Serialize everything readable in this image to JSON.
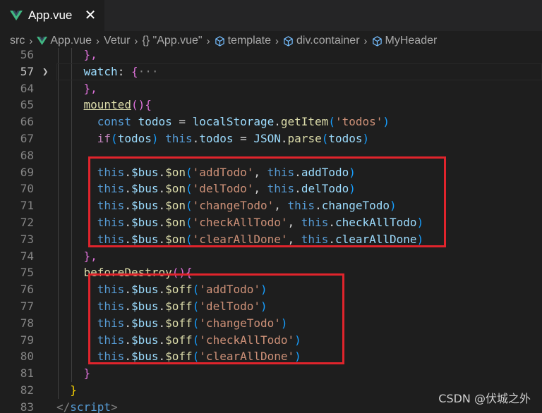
{
  "tab": {
    "title": "App.vue",
    "close": "✕"
  },
  "breadcrumbs": {
    "items": [
      "src",
      "App.vue",
      "Vetur",
      "{} \"App.vue\"",
      "template",
      "div.container",
      "MyHeader"
    ]
  },
  "lines": [
    {
      "n": "56",
      "tokens": [
        {
          "t": "},",
          "c": "k-brk2"
        }
      ]
    },
    {
      "n": "57",
      "fold": true,
      "tokens": [
        {
          "t": "watch",
          "c": "k-var"
        },
        {
          "t": ": ",
          "c": "k-plain"
        },
        {
          "t": "{",
          "c": "k-brk2"
        },
        {
          "t": "···",
          "c": "k-grey"
        }
      ]
    },
    {
      "n": "64",
      "tokens": [
        {
          "t": "},",
          "c": "k-brk2"
        }
      ]
    },
    {
      "n": "65",
      "tokens": [
        {
          "t": "mounted",
          "c": "k-fn underline"
        },
        {
          "t": "(){",
          "c": "k-brk2"
        }
      ]
    },
    {
      "n": "66",
      "tokens": [
        {
          "t": "  const ",
          "c": "k-blue"
        },
        {
          "t": "todos",
          "c": "k-var"
        },
        {
          "t": " = ",
          "c": "k-plain"
        },
        {
          "t": "localStorage",
          "c": "k-var"
        },
        {
          "t": ".",
          "c": "k-plain"
        },
        {
          "t": "getItem",
          "c": "k-fn"
        },
        {
          "t": "(",
          "c": "k-brk3"
        },
        {
          "t": "'todos'",
          "c": "k-str"
        },
        {
          "t": ")",
          "c": "k-brk3"
        }
      ]
    },
    {
      "n": "67",
      "tokens": [
        {
          "t": "  if",
          "c": "k-purple"
        },
        {
          "t": "(",
          "c": "k-brk3"
        },
        {
          "t": "todos",
          "c": "k-var"
        },
        {
          "t": ") ",
          "c": "k-brk3"
        },
        {
          "t": "this",
          "c": "k-blue"
        },
        {
          "t": ".",
          "c": "k-plain"
        },
        {
          "t": "todos",
          "c": "k-var"
        },
        {
          "t": " = ",
          "c": "k-plain"
        },
        {
          "t": "JSON",
          "c": "k-var"
        },
        {
          "t": ".",
          "c": "k-plain"
        },
        {
          "t": "parse",
          "c": "k-fn"
        },
        {
          "t": "(",
          "c": "k-brk3"
        },
        {
          "t": "todos",
          "c": "k-var"
        },
        {
          "t": ")",
          "c": "k-brk3"
        }
      ]
    },
    {
      "n": "68",
      "tokens": []
    },
    {
      "n": "69",
      "tokens": [
        {
          "t": "  this",
          "c": "k-blue"
        },
        {
          "t": ".",
          "c": "k-plain"
        },
        {
          "t": "$bus",
          "c": "k-var"
        },
        {
          "t": ".",
          "c": "k-plain"
        },
        {
          "t": "$on",
          "c": "k-fn"
        },
        {
          "t": "(",
          "c": "k-brk3"
        },
        {
          "t": "'addTodo'",
          "c": "k-str"
        },
        {
          "t": ", ",
          "c": "k-plain"
        },
        {
          "t": "this",
          "c": "k-blue"
        },
        {
          "t": ".",
          "c": "k-plain"
        },
        {
          "t": "addTodo",
          "c": "k-var"
        },
        {
          "t": ")",
          "c": "k-brk3"
        }
      ]
    },
    {
      "n": "70",
      "tokens": [
        {
          "t": "  this",
          "c": "k-blue"
        },
        {
          "t": ".",
          "c": "k-plain"
        },
        {
          "t": "$bus",
          "c": "k-var"
        },
        {
          "t": ".",
          "c": "k-plain"
        },
        {
          "t": "$on",
          "c": "k-fn"
        },
        {
          "t": "(",
          "c": "k-brk3"
        },
        {
          "t": "'delTodo'",
          "c": "k-str"
        },
        {
          "t": ", ",
          "c": "k-plain"
        },
        {
          "t": "this",
          "c": "k-blue"
        },
        {
          "t": ".",
          "c": "k-plain"
        },
        {
          "t": "delTodo",
          "c": "k-var"
        },
        {
          "t": ")",
          "c": "k-brk3"
        }
      ]
    },
    {
      "n": "71",
      "tokens": [
        {
          "t": "  this",
          "c": "k-blue"
        },
        {
          "t": ".",
          "c": "k-plain"
        },
        {
          "t": "$bus",
          "c": "k-var"
        },
        {
          "t": ".",
          "c": "k-plain"
        },
        {
          "t": "$on",
          "c": "k-fn"
        },
        {
          "t": "(",
          "c": "k-brk3"
        },
        {
          "t": "'changeTodo'",
          "c": "k-str"
        },
        {
          "t": ", ",
          "c": "k-plain"
        },
        {
          "t": "this",
          "c": "k-blue"
        },
        {
          "t": ".",
          "c": "k-plain"
        },
        {
          "t": "changeTodo",
          "c": "k-var"
        },
        {
          "t": ")",
          "c": "k-brk3"
        }
      ]
    },
    {
      "n": "72",
      "tokens": [
        {
          "t": "  this",
          "c": "k-blue"
        },
        {
          "t": ".",
          "c": "k-plain"
        },
        {
          "t": "$bus",
          "c": "k-var"
        },
        {
          "t": ".",
          "c": "k-plain"
        },
        {
          "t": "$on",
          "c": "k-fn"
        },
        {
          "t": "(",
          "c": "k-brk3"
        },
        {
          "t": "'checkAllTodo'",
          "c": "k-str"
        },
        {
          "t": ", ",
          "c": "k-plain"
        },
        {
          "t": "this",
          "c": "k-blue"
        },
        {
          "t": ".",
          "c": "k-plain"
        },
        {
          "t": "checkAllTodo",
          "c": "k-var"
        },
        {
          "t": ")",
          "c": "k-brk3"
        }
      ]
    },
    {
      "n": "73",
      "tokens": [
        {
          "t": "  this",
          "c": "k-blue"
        },
        {
          "t": ".",
          "c": "k-plain"
        },
        {
          "t": "$bus",
          "c": "k-var"
        },
        {
          "t": ".",
          "c": "k-plain"
        },
        {
          "t": "$on",
          "c": "k-fn"
        },
        {
          "t": "(",
          "c": "k-brk3"
        },
        {
          "t": "'clearAllDone'",
          "c": "k-str"
        },
        {
          "t": ", ",
          "c": "k-plain"
        },
        {
          "t": "this",
          "c": "k-blue"
        },
        {
          "t": ".",
          "c": "k-plain"
        },
        {
          "t": "clearAllDone",
          "c": "k-var"
        },
        {
          "t": ")",
          "c": "k-brk3"
        }
      ]
    },
    {
      "n": "74",
      "tokens": [
        {
          "t": "},",
          "c": "k-brk2"
        }
      ]
    },
    {
      "n": "75",
      "tokens": [
        {
          "t": "beforeDestroy",
          "c": "k-fn"
        },
        {
          "t": "(){",
          "c": "k-brk2"
        }
      ]
    },
    {
      "n": "76",
      "tokens": [
        {
          "t": "  this",
          "c": "k-blue"
        },
        {
          "t": ".",
          "c": "k-plain"
        },
        {
          "t": "$bus",
          "c": "k-var"
        },
        {
          "t": ".",
          "c": "k-plain"
        },
        {
          "t": "$off",
          "c": "k-fn"
        },
        {
          "t": "(",
          "c": "k-brk3"
        },
        {
          "t": "'addTodo'",
          "c": "k-str"
        },
        {
          "t": ")",
          "c": "k-brk3"
        }
      ]
    },
    {
      "n": "77",
      "tokens": [
        {
          "t": "  this",
          "c": "k-blue"
        },
        {
          "t": ".",
          "c": "k-plain"
        },
        {
          "t": "$bus",
          "c": "k-var"
        },
        {
          "t": ".",
          "c": "k-plain"
        },
        {
          "t": "$off",
          "c": "k-fn"
        },
        {
          "t": "(",
          "c": "k-brk3"
        },
        {
          "t": "'delTodo'",
          "c": "k-str"
        },
        {
          "t": ")",
          "c": "k-brk3"
        }
      ]
    },
    {
      "n": "78",
      "tokens": [
        {
          "t": "  this",
          "c": "k-blue"
        },
        {
          "t": ".",
          "c": "k-plain"
        },
        {
          "t": "$bus",
          "c": "k-var"
        },
        {
          "t": ".",
          "c": "k-plain"
        },
        {
          "t": "$off",
          "c": "k-fn"
        },
        {
          "t": "(",
          "c": "k-brk3"
        },
        {
          "t": "'changeTodo'",
          "c": "k-str"
        },
        {
          "t": ")",
          "c": "k-brk3"
        }
      ]
    },
    {
      "n": "79",
      "tokens": [
        {
          "t": "  this",
          "c": "k-blue"
        },
        {
          "t": ".",
          "c": "k-plain"
        },
        {
          "t": "$bus",
          "c": "k-var"
        },
        {
          "t": ".",
          "c": "k-plain"
        },
        {
          "t": "$off",
          "c": "k-fn"
        },
        {
          "t": "(",
          "c": "k-brk3"
        },
        {
          "t": "'checkAllTodo'",
          "c": "k-str"
        },
        {
          "t": ")",
          "c": "k-brk3"
        }
      ]
    },
    {
      "n": "80",
      "tokens": [
        {
          "t": "  this",
          "c": "k-blue"
        },
        {
          "t": ".",
          "c": "k-plain"
        },
        {
          "t": "$bus",
          "c": "k-var"
        },
        {
          "t": ".",
          "c": "k-plain"
        },
        {
          "t": "$off",
          "c": "k-fn"
        },
        {
          "t": "(",
          "c": "k-brk3"
        },
        {
          "t": "'clearAllDone'",
          "c": "k-str"
        },
        {
          "t": ")",
          "c": "k-brk3"
        }
      ]
    },
    {
      "n": "81",
      "tokens": [
        {
          "t": "}",
          "c": "k-brk2"
        }
      ]
    },
    {
      "n": "82",
      "tokens": [
        {
          "t": "}",
          "c": "k-brk1"
        }
      ]
    },
    {
      "n": "83",
      "tokens": [
        {
          "t": "</",
          "c": "k-grey"
        },
        {
          "t": "script",
          "c": "k-blue"
        },
        {
          "t": ">",
          "c": "k-grey"
        }
      ]
    }
  ],
  "line_indent": {
    "56": 2,
    "57": 2,
    "64": 2,
    "65": 2,
    "66": 2,
    "67": 2,
    "68": 2,
    "69": 2,
    "70": 2,
    "71": 2,
    "72": 2,
    "73": 2,
    "74": 2,
    "75": 2,
    "76": 2,
    "77": 2,
    "78": 2,
    "79": 2,
    "80": 2,
    "81": 2,
    "82": 1,
    "83": 0
  },
  "active_line": "57",
  "watermark": "CSDN @伏城之外",
  "colors": {
    "highlight_box": "#e0242c",
    "vue_green": "#41b883"
  }
}
